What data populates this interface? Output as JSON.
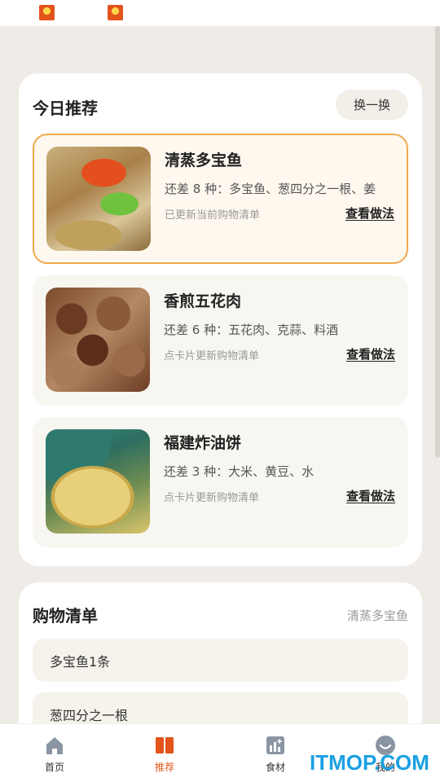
{
  "statusbar": {
    "icons": [
      "app-notification-icon",
      "app-notification-icon"
    ]
  },
  "recommend": {
    "title": "今日推荐",
    "swap_label": "换一换",
    "recipes": [
      {
        "name": "清蒸多宝鱼",
        "missing": "还差 8 种：多宝鱼、葱四分之一根、姜",
        "status": "已更新当前购物清单",
        "link": "查看做法",
        "selected": true,
        "image": "steamed-turbot-photo"
      },
      {
        "name": "香煎五花肉",
        "missing": "还差 6 种：五花肉、克蒜、料酒",
        "status": "点卡片更新购物清单",
        "link": "查看做法",
        "selected": false,
        "image": "fried-pork-belly-photo"
      },
      {
        "name": "福建炸油饼",
        "missing": "还差 3 种：大米、黄豆、水",
        "status": "点卡片更新购物清单",
        "link": "查看做法",
        "selected": false,
        "image": "fried-oil-cake-photo"
      }
    ]
  },
  "shopping": {
    "title": "购物清单",
    "current_recipe": "清蒸多宝鱼",
    "items": [
      "多宝鱼1条",
      "葱四分之一根"
    ]
  },
  "tabbar": {
    "tabs": [
      {
        "label": "首页",
        "icon": "home-icon",
        "active": false
      },
      {
        "label": "推荐",
        "icon": "book-icon",
        "active": true
      },
      {
        "label": "食材",
        "icon": "ingredients-chart-icon",
        "active": false
      },
      {
        "label": "我的",
        "icon": "profile-smile-icon",
        "active": false
      }
    ]
  },
  "watermark": "ITMOP.COM",
  "colors": {
    "accent": "#e2541b",
    "selected_border": "#f0a94c",
    "background": "#efebe6"
  }
}
